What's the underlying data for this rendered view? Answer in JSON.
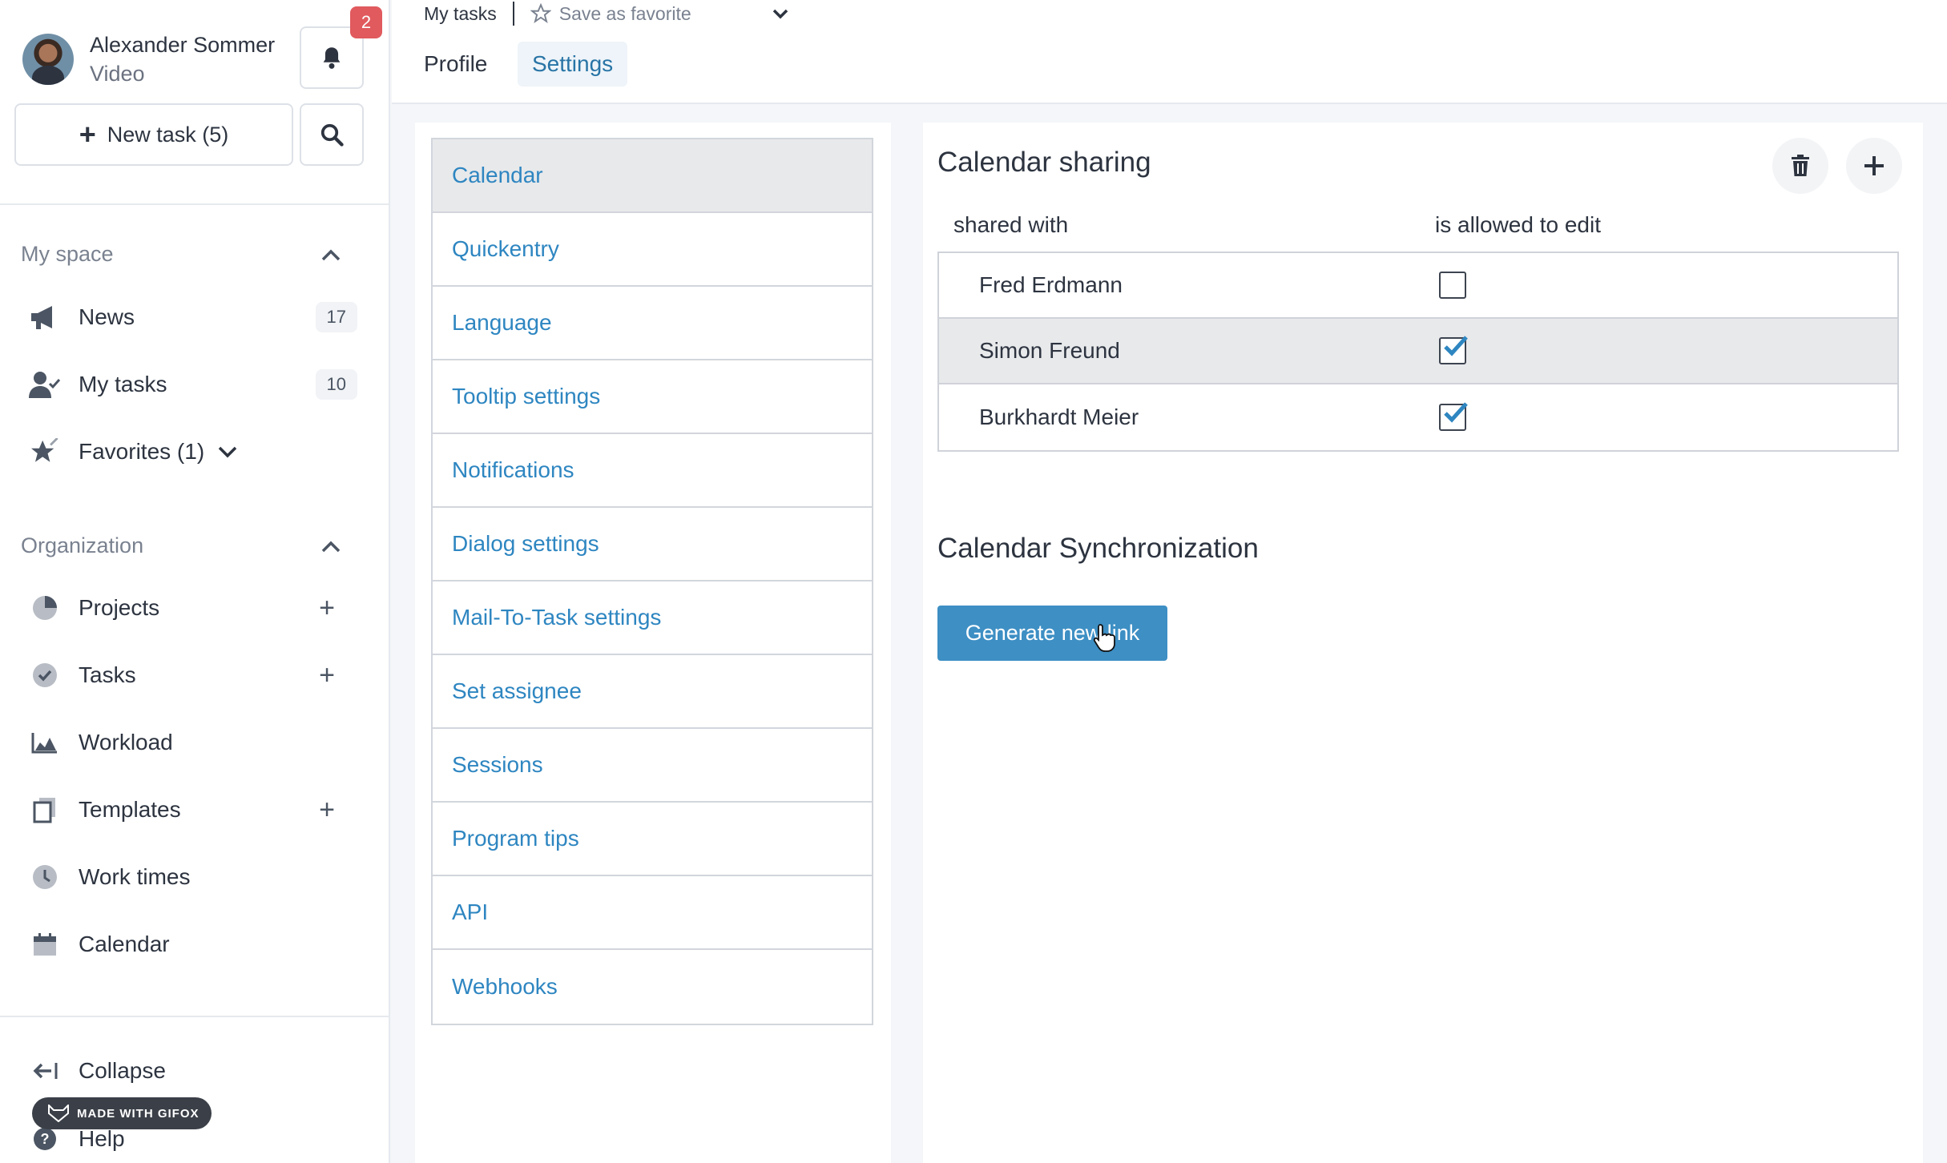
{
  "user": {
    "name": "Alexander Sommer",
    "subtitle": "Video",
    "notification_count": "2"
  },
  "sidebar": {
    "new_task_label": "New task (5)",
    "my_space": {
      "title": "My space",
      "items": [
        {
          "label": "News",
          "count": "17",
          "icon": "megaphone-icon"
        },
        {
          "label": "My tasks",
          "count": "10",
          "icon": "user-check-icon"
        },
        {
          "label": "Favorites (1)",
          "icon": "star-icon"
        }
      ]
    },
    "organization": {
      "title": "Organization",
      "items": [
        {
          "label": "Projects",
          "icon": "pie-chart-icon"
        },
        {
          "label": "Tasks",
          "icon": "check-circle-icon"
        },
        {
          "label": "Workload",
          "icon": "area-chart-icon"
        },
        {
          "label": "Templates",
          "icon": "copy-icon"
        },
        {
          "label": "Work times",
          "icon": "clock-icon"
        },
        {
          "label": "Calendar",
          "icon": "calendar-icon"
        }
      ]
    },
    "footer": {
      "collapse_label": "Collapse",
      "help_label": "Help"
    },
    "watermark": "MADE WITH GIFOX"
  },
  "header": {
    "breadcrumb": "My tasks",
    "favorite_label": "Save as favorite",
    "tabs": [
      {
        "label": "Profile"
      },
      {
        "label": "Settings",
        "active": true
      }
    ]
  },
  "settings_menu": {
    "items": [
      {
        "label": "Calendar",
        "active": true
      },
      {
        "label": "Quickentry"
      },
      {
        "label": "Language"
      },
      {
        "label": "Tooltip settings"
      },
      {
        "label": "Notifications"
      },
      {
        "label": "Dialog settings"
      },
      {
        "label": "Mail-To-Task settings"
      },
      {
        "label": "Set assignee"
      },
      {
        "label": "Sessions"
      },
      {
        "label": "Program tips"
      },
      {
        "label": "API"
      },
      {
        "label": "Webhooks"
      }
    ]
  },
  "calendar_sharing": {
    "title": "Calendar sharing",
    "col_shared_with": "shared with",
    "col_allowed_edit": "is allowed to edit",
    "rows": [
      {
        "name": "Fred Erdmann",
        "can_edit": false
      },
      {
        "name": "Simon Freund",
        "can_edit": true
      },
      {
        "name": "Burkhardt Meier",
        "can_edit": true
      }
    ]
  },
  "calendar_sync": {
    "title": "Calendar Synchronization",
    "button_label": "Generate new link"
  },
  "colors": {
    "link_blue": "#2e86c1",
    "primary_button": "#3d8fc4",
    "badge_red": "#e05a5e"
  }
}
